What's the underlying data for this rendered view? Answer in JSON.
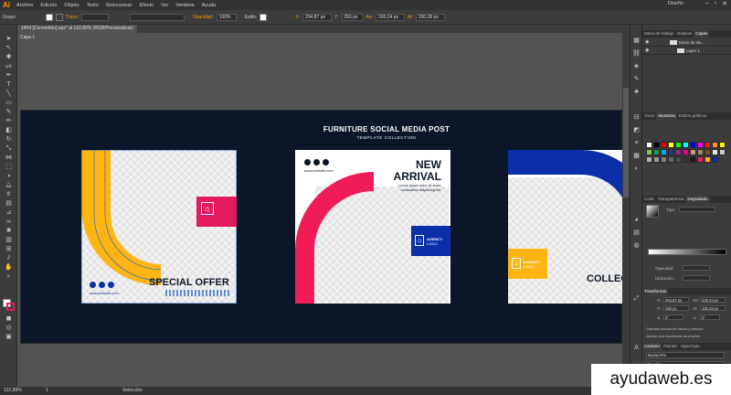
{
  "app": {
    "logo": "Ai",
    "menu": [
      "Archivo",
      "Edición",
      "Objeto",
      "Texto",
      "Seleccionar",
      "Efecto",
      "Ver",
      "Ventana",
      "Ayuda"
    ],
    "workspace": "Diseño",
    "window_buttons": [
      "–",
      "▫",
      "✕"
    ]
  },
  "control_bar": {
    "group_label": "Grupo",
    "stroke_label": "Trazo:",
    "opacity_label": "Opacidad:",
    "opacity_value": "100%",
    "style_label": "Estilo:",
    "x_label": "X:",
    "x_value": "294,87 px",
    "y_label": "Y:",
    "y_value": "250 px",
    "w_label": "An:",
    "w_value": "330,24 px",
    "h_label": "Al:",
    "h_value": "330,28 px"
  },
  "document_tab": "1404 [Convertido].eps* al 122,89% (RGB/Previsualizar)",
  "layer_tab": "Capa 1",
  "artboard": {
    "title": "FURNITURE SOCIAL MEDIA POST",
    "subtitle": "TEMPLATE COLLECTION",
    "post1": {
      "heading": "SPECIAL OFFER",
      "website": "www.website.com"
    },
    "post2": {
      "website": "www.website.com",
      "line1": "NEW",
      "line2": "ARRIVAL",
      "blurb1": "Lorem ipsum dolor sit amet,",
      "blurb2": "consectetur adipiscing elit.",
      "logo_line1": "AGENCY",
      "logo_line2": "LOGO"
    },
    "post3": {
      "heading": "COLLEC",
      "logo_line1": "AGENCY",
      "logo_line2": "LOGO"
    },
    "colors": {
      "background": "#0b1628",
      "yellow": "#ffb511",
      "pink": "#ef1c58",
      "blue": "#0a2fa8",
      "pink_logo": "#e4195f"
    }
  },
  "panels": {
    "top_tabs": [
      "Mesa de trabajo",
      "Enlaces",
      "Capas"
    ],
    "layers": [
      {
        "name": "Modo de sis..."
      },
      {
        "name": "Layer 1"
      }
    ],
    "swatch_tabs": [
      "Trazo",
      "Muestras",
      "Estilos gráficos"
    ],
    "color_tabs": [
      "Color",
      "Transparencia",
      "Degradado"
    ],
    "gradient": {
      "type_label": "Tipo:",
      "opacity_label": "Opacidad:",
      "location_label": "Ubicación:"
    },
    "transform": {
      "title": "Transformar",
      "x_label": "X:",
      "x_value": "294,87 px",
      "y_label": "Y:",
      "y_value": "250 px",
      "w_label": "An:",
      "w_value": "330,24 px",
      "h_label": "Al:",
      "h_value": "330,28 px",
      "angle_value": "0°",
      "shear_value": "0°",
      "opt1": "Cambiar escala de trazos y efectos",
      "opt2": "Alinear con cuadrícula de píxeles"
    },
    "char_tabs": [
      "Carácter",
      "Párrafo",
      "OpenType"
    ],
    "font_value": "Myriad Pro",
    "font_style": "Regular"
  },
  "status": {
    "zoom": "122,89%",
    "page": "1",
    "mode": "Selección"
  },
  "watermark": "ayudaweb.es"
}
